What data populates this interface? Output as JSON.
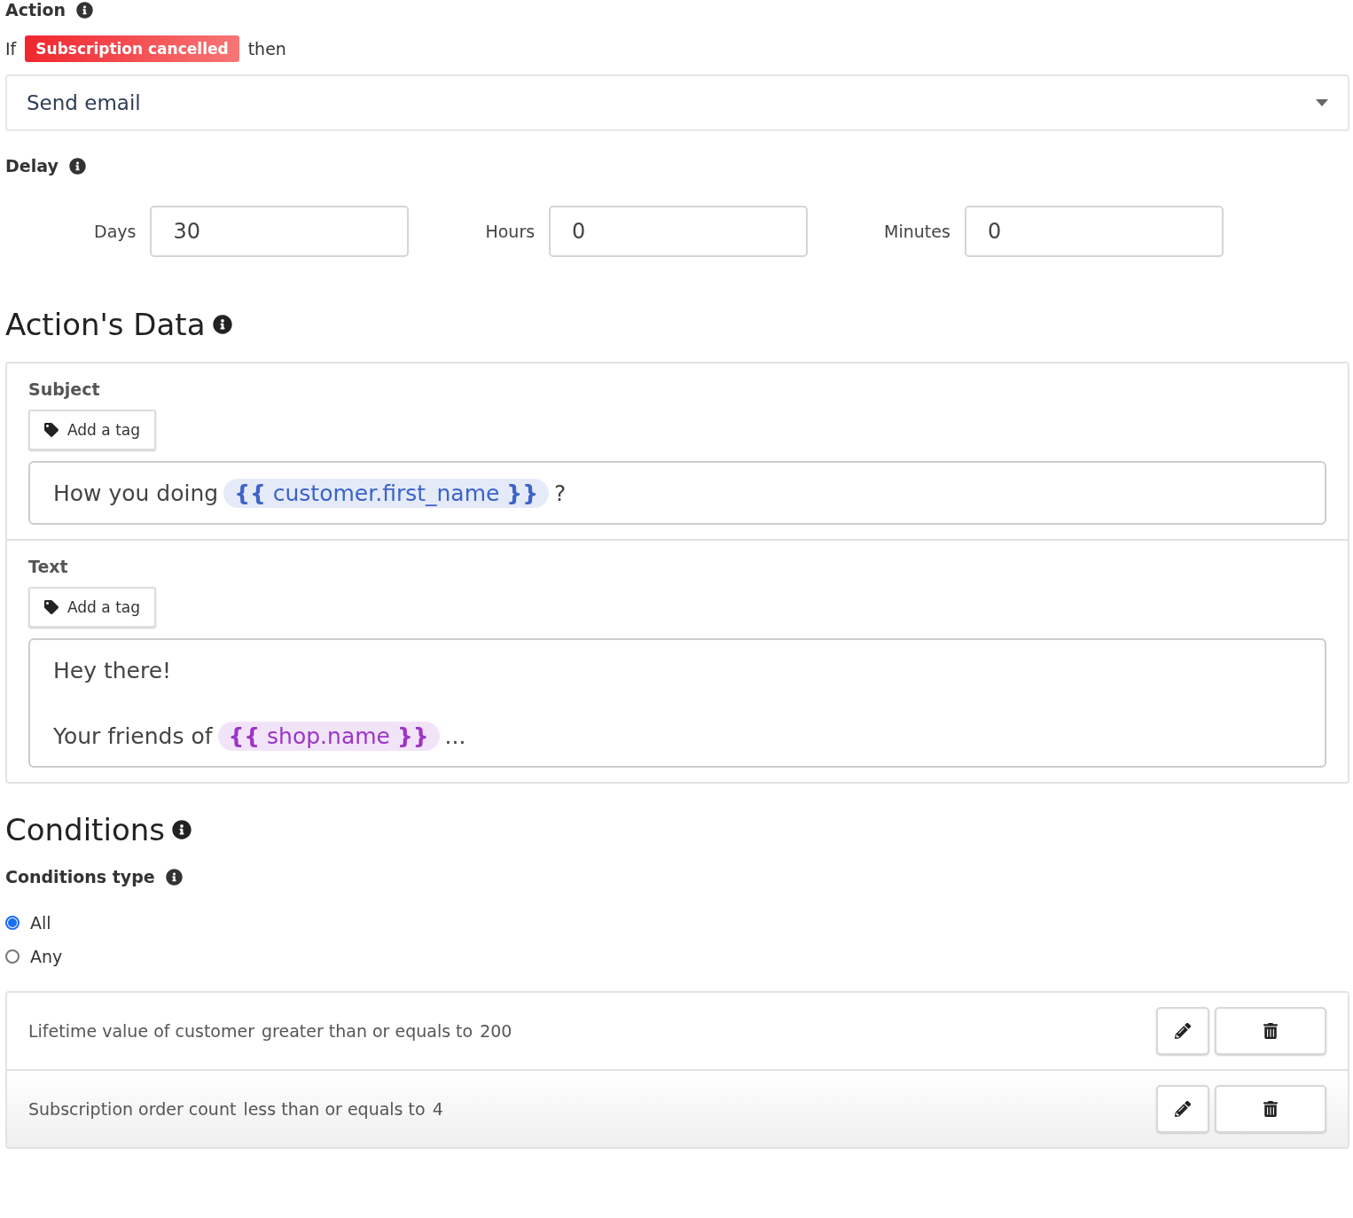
{
  "action": {
    "label": "Action",
    "if_text": "If",
    "trigger": "Subscription cancelled",
    "then_text": "then",
    "select": {
      "value": "Send email"
    }
  },
  "delay": {
    "label": "Delay",
    "fields": [
      {
        "label": "Days",
        "value": "30"
      },
      {
        "label": "Hours",
        "value": "0"
      },
      {
        "label": "Minutes",
        "value": "0"
      }
    ]
  },
  "actions_data": {
    "title": "Action's Data",
    "sections": [
      {
        "label": "Subject",
        "button": "Add a tag",
        "lines": [
          [
            {
              "kind": "text",
              "text": "How you doing"
            },
            {
              "kind": "token",
              "text": "**{{** customer.first_name **}}**",
              "color": "#3b63c9"
            },
            {
              "kind": "text",
              "text": "?"
            }
          ]
        ]
      },
      {
        "label": "Text",
        "button": "Add a tag",
        "lines": [
          [
            {
              "kind": "text",
              "text": "Hey there!"
            }
          ],
          [
            {
              "kind": "text",
              "text": "Your friends of"
            },
            {
              "kind": "token",
              "text": "**{{** shop.name **}}**",
              "color": "#9b35c8"
            },
            {
              "kind": "text",
              "text": "..."
            }
          ]
        ]
      }
    ]
  },
  "conditions": {
    "title": "Conditions",
    "type_label": "Conditions type",
    "options": [
      {
        "label": "All",
        "selected": true
      },
      {
        "label": "Any",
        "selected": false
      }
    ],
    "rows": [
      {
        "field": "Lifetime value of customer",
        "operator": "greater than or equals to",
        "value": "200"
      },
      {
        "field": "Subscription order count",
        "operator": "less than or equals to",
        "value": "4"
      }
    ]
  }
}
